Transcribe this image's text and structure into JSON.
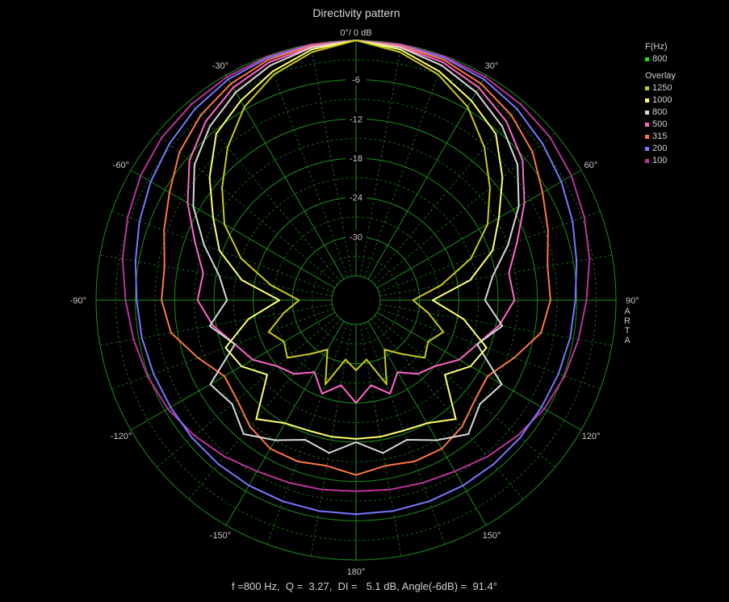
{
  "title": "Directivity pattern",
  "footer": "f =800 Hz,  Q =  3.27,  DI =   5.1 dB, Angle(-6dB) =  91.4°",
  "watermark": "ARTA",
  "top_label": "0°/ 0 dB",
  "legend": {
    "header": "F(Hz)",
    "main": {
      "label": "800",
      "color": "#22dd22"
    },
    "overlay_header": "Overlay",
    "overlays": [
      {
        "label": "1250",
        "color": "#c8c820"
      },
      {
        "label": "1000",
        "color": "#ffff70"
      },
      {
        "label": "800",
        "color": "#d8d8d8"
      },
      {
        "label": "500",
        "color": "#ff66cc"
      },
      {
        "label": "315",
        "color": "#ff7744"
      },
      {
        "label": "200",
        "color": "#7777ff"
      },
      {
        "label": "100",
        "color": "#bb3399"
      }
    ]
  },
  "chart_data": {
    "type": "polar",
    "title": "Directivity pattern",
    "radial_unit": "dB",
    "radial_range": [
      -36,
      0
    ],
    "radial_ticks": [
      "-6",
      "-12",
      "-18",
      "-24",
      "-30"
    ],
    "angle_labels": [
      {
        "angle": -30,
        "label": "-30°"
      },
      {
        "angle": 30,
        "label": "30°"
      },
      {
        "angle": -60,
        "label": "-60°"
      },
      {
        "angle": 60,
        "label": "60°"
      },
      {
        "angle": -90,
        "label": "-90°"
      },
      {
        "angle": 90,
        "label": "90°"
      },
      {
        "angle": -120,
        "label": "-120°"
      },
      {
        "angle": 120,
        "label": "120°"
      },
      {
        "angle": -150,
        "label": "-150°"
      },
      {
        "angle": 150,
        "label": "150°"
      },
      {
        "angle": 180,
        "label": "180°"
      }
    ],
    "angles_deg": [
      0,
      10,
      20,
      30,
      40,
      50,
      60,
      70,
      80,
      90,
      100,
      110,
      120,
      130,
      140,
      150,
      160,
      170,
      180
    ],
    "series": [
      {
        "name": "1250",
        "color": "#c8c820",
        "symmetric": true,
        "values": [
          0,
          -1.2,
          -3,
          -5.6,
          -9.2,
          -13,
          -16.5,
          -21,
          -26.5,
          -31,
          -28.5,
          -25.5,
          -27,
          -26,
          -29,
          -31,
          -26,
          -30.5,
          -29
        ]
      },
      {
        "name": "1000",
        "color": "#ffff70",
        "symmetric": true,
        "values": [
          0,
          -0.8,
          -2.5,
          -4.5,
          -6.5,
          -10.5,
          -14.5,
          -17.5,
          -22,
          -28,
          -23,
          -18.5,
          -19.5,
          -22,
          -16,
          -18,
          -18.5,
          -18.5,
          -18.5
        ]
      },
      {
        "name": "800",
        "color": "#d8d8d8",
        "symmetric": true,
        "values": [
          0,
          -0.5,
          -1.5,
          -3,
          -5,
          -7.5,
          -11,
          -15,
          -18.5,
          -20,
          -17,
          -20,
          -14,
          -15,
          -13,
          -15,
          -17,
          -16,
          -18
        ]
      },
      {
        "name": "500",
        "color": "#ff66cc",
        "symmetric": true,
        "values": [
          0,
          -0.4,
          -1,
          -2.2,
          -4,
          -6.5,
          -10,
          -13.5,
          -16,
          -15.5,
          -17.5,
          -20,
          -21.5,
          -24,
          -25,
          -27,
          -24.5,
          -26.5,
          -24
        ]
      },
      {
        "name": "315",
        "color": "#ff7744",
        "symmetric": true,
        "values": [
          0,
          -0.2,
          -0.6,
          -1.5,
          -2.8,
          -4.5,
          -6.8,
          -8.5,
          -10,
          -10,
          -11,
          -14,
          -16.5,
          -16,
          -14.5,
          -13.5,
          -13.5,
          -14,
          -13
        ]
      },
      {
        "name": "200",
        "color": "#7777ff",
        "symmetric": true,
        "values": [
          0,
          -0.1,
          -0.3,
          -0.7,
          -1.5,
          -2.5,
          -3.5,
          -4.5,
          -5.5,
          -6.2,
          -6.5,
          -6.8,
          -7,
          -7,
          -7,
          -7,
          -7,
          -7,
          -7
        ]
      },
      {
        "name": "100",
        "color": "#bb3399",
        "symmetric": true,
        "values": [
          0,
          0,
          -0.1,
          -0.3,
          -0.6,
          -1,
          -1.7,
          -2.6,
          -3.5,
          -4.5,
          -5.2,
          -5.8,
          -6.5,
          -7.5,
          -8.5,
          -9.5,
          -10,
          -10.3,
          -10.5
        ]
      }
    ]
  }
}
